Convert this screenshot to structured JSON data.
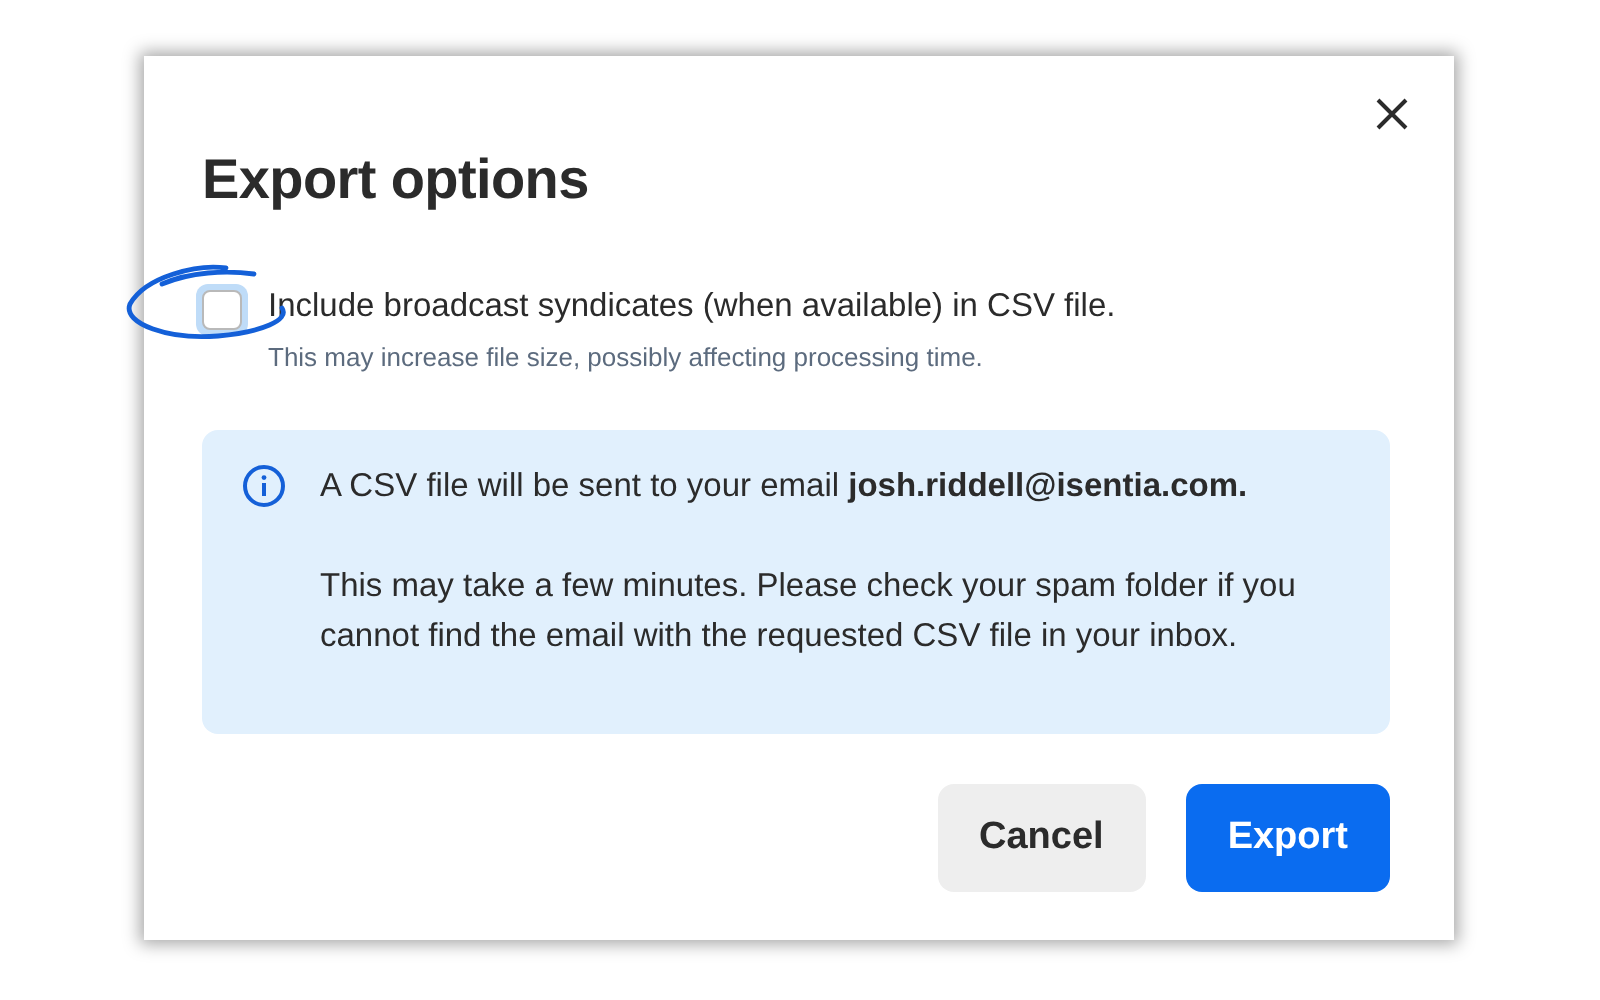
{
  "dialog": {
    "title": "Export options",
    "option": {
      "label": "Include broadcast syndicates (when available) in CSV file.",
      "hint": "This may increase file size, possibly affecting processing time.",
      "checked": false,
      "focused": true,
      "annotated": true
    },
    "info": {
      "paragraphs": [
        "A CSV file will be sent to your email **josh.riddell@isentia.com.**",
        "This may take a few minutes. Please check your spam folder if you cannot find the email with the requested CSV file in your inbox."
      ]
    },
    "buttons": [
      {
        "label": "Cancel",
        "kind": "secondary"
      },
      {
        "label": "Export",
        "kind": "primary"
      }
    ]
  }
}
